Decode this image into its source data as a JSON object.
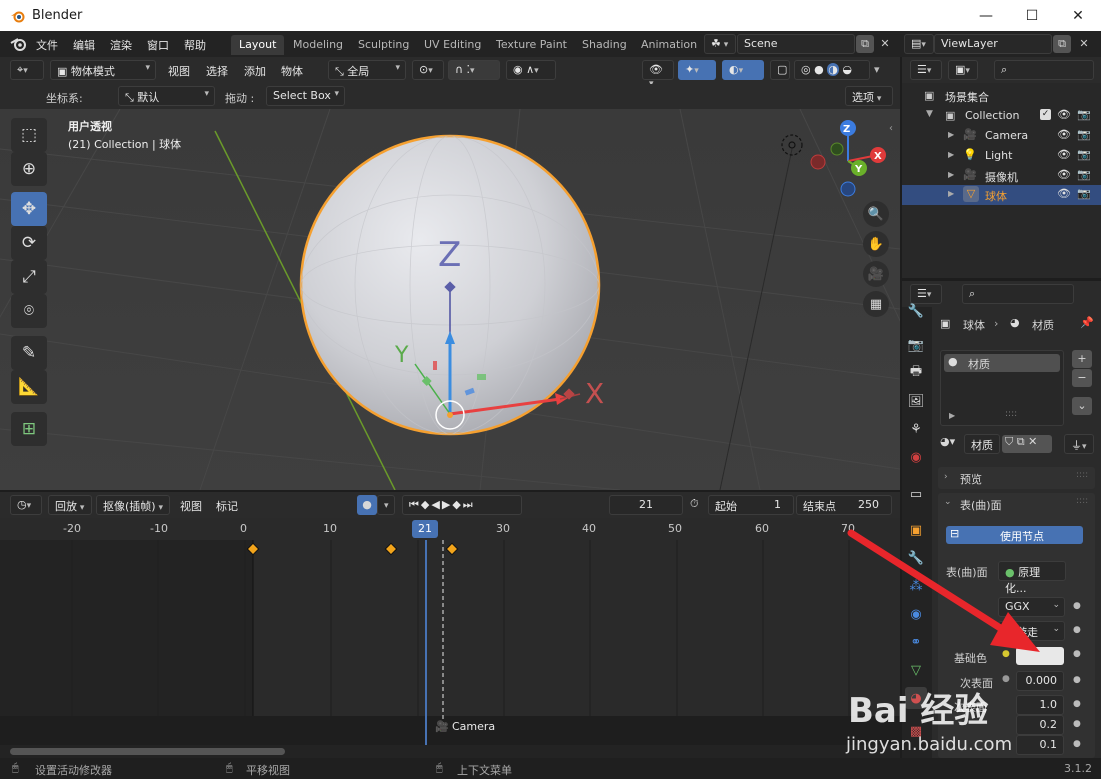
{
  "window": {
    "title": "Blender",
    "minimize": "—",
    "maximize": "☐",
    "close": "✕"
  },
  "menu": [
    "文件",
    "编辑",
    "渲染",
    "窗口",
    "帮助"
  ],
  "workspaces": [
    "Layout",
    "Modeling",
    "Sculpting",
    "UV Editing",
    "Texture Paint",
    "Shading",
    "Animation"
  ],
  "active_workspace": "Layout",
  "scene": {
    "name": "Scene"
  },
  "viewlayer": {
    "name": "ViewLayer"
  },
  "viewport_header": {
    "mode": "物体模式",
    "view": "视图",
    "select": "选择",
    "add": "添加",
    "object": "物体",
    "transform_orientation": "全局"
  },
  "viewport_header2": {
    "coord_label": "坐标系:",
    "coord_value": "默认",
    "drag_label": "拖动 :",
    "drag_value": "Select Box",
    "options": "选项"
  },
  "viewport": {
    "view_name": "用户透视",
    "collection_info": "(21) Collection | 球体",
    "axis_x": "X",
    "axis_y": "Y",
    "axis_z": "Z",
    "gizmo_x": "X",
    "gizmo_y": "Y",
    "gizmo_z": "Z"
  },
  "timeline_header": {
    "playback": "回放",
    "keying": "抠像(插帧)",
    "view": "视图",
    "marker": "标记",
    "current_frame": "21",
    "start_label": "起始",
    "start_value": "1",
    "end_label": "结束点",
    "end_value": "250"
  },
  "timeline_ruler": [
    "-20",
    "-10",
    "0",
    "10",
    "21",
    "30",
    "40",
    "50",
    "60",
    "70"
  ],
  "timeline": {
    "current_frame_badge": "21",
    "camera_marker": "Camera"
  },
  "statusbar": {
    "left": "设置活动修改器",
    "middle": "平移视图",
    "right": "上下文菜单",
    "version": "3.1.2"
  },
  "outliner": {
    "root": "场景集合",
    "items": [
      {
        "label": "Collection",
        "level": 1
      },
      {
        "label": "Camera",
        "level": 2
      },
      {
        "label": "Light",
        "level": 2
      },
      {
        "label": "摄像机",
        "level": 2
      },
      {
        "label": "球体",
        "level": 2,
        "selected": true
      }
    ]
  },
  "properties": {
    "breadcrumb_object": "球体",
    "breadcrumb_material": "材质",
    "material_slot": "材质",
    "material_name": "材质",
    "preview_panel": "预览",
    "surface_panel": "表(曲)面",
    "use_nodes": "使用节点",
    "surface_label": "表(曲)面",
    "surface_value": "原理化...",
    "distribution": "GGX",
    "subsurface_method": "机游走",
    "base_color_label": "基础色",
    "subsurface_label": "次表面",
    "subsurface_value": "0.000",
    "row_a_label": "次表面",
    "row_a_value": "1.0",
    "row_b_value": "0.2",
    "row_c_value": "0.1"
  },
  "colors": {
    "accent": "#4772b3",
    "selection_orange": "#f5a030",
    "keyframe": "#f2a41b",
    "arrow_red": "#e8262b"
  },
  "watermark": {
    "text": "Bai 经验",
    "url": "jingyan.baidu.com"
  }
}
